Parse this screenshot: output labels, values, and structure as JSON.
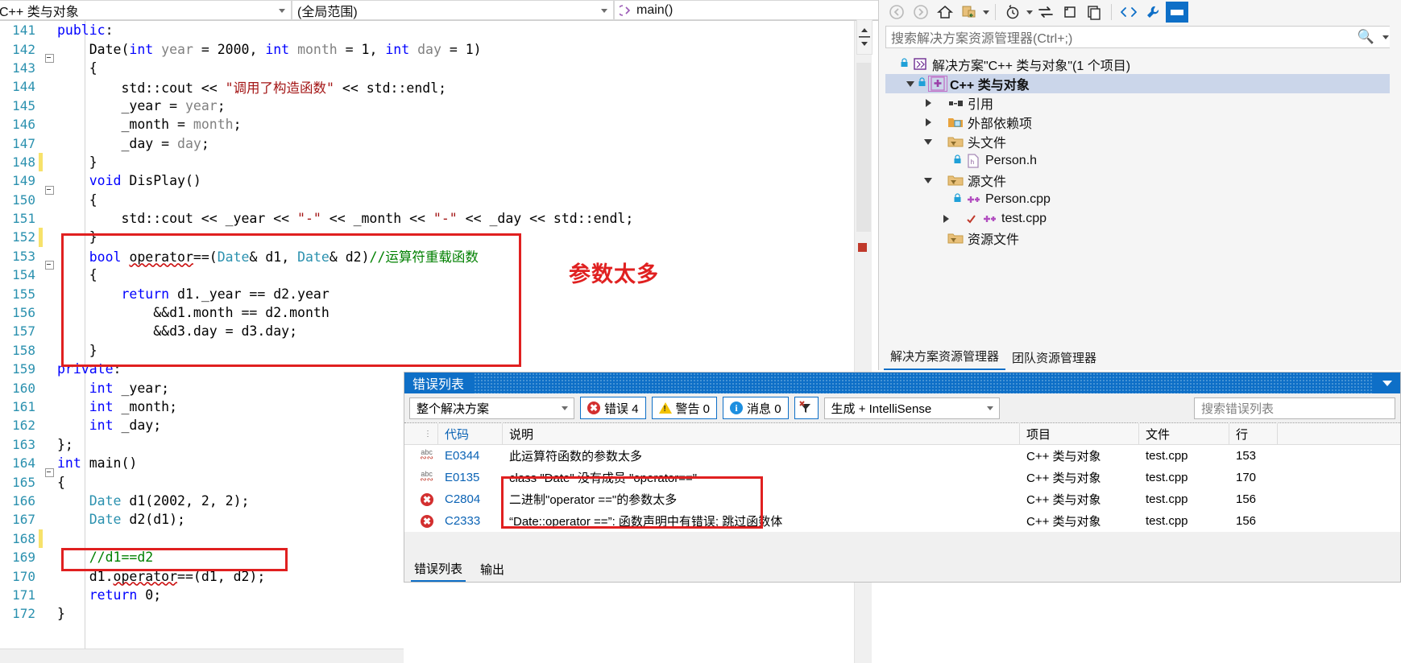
{
  "editor_nav": {
    "project_combo": "C++ 类与对象",
    "scope_combo": "(全局范围)",
    "member_combo": "main()",
    "member_icon": "method-icon"
  },
  "code": {
    "lines": [
      {
        "n": "141",
        "indent": 0,
        "glyph": "",
        "change": "",
        "tokens": [
          {
            "t": "public",
            "c": "kw"
          },
          {
            "t": ":",
            "c": "plain"
          }
        ]
      },
      {
        "n": "142",
        "indent": 0,
        "glyph": "box",
        "change": "",
        "tokens": [
          {
            "t": "    Date(",
            "c": "plain"
          },
          {
            "t": "int",
            "c": "kw"
          },
          {
            "t": " ",
            "c": "plain"
          },
          {
            "t": "year",
            "c": "param"
          },
          {
            "t": " = 2000, ",
            "c": "plain"
          },
          {
            "t": "int",
            "c": "kw"
          },
          {
            "t": " ",
            "c": "plain"
          },
          {
            "t": "month",
            "c": "param"
          },
          {
            "t": " = 1, ",
            "c": "plain"
          },
          {
            "t": "int",
            "c": "kw"
          },
          {
            "t": " ",
            "c": "plain"
          },
          {
            "t": "day",
            "c": "param"
          },
          {
            "t": " = 1)",
            "c": "plain"
          }
        ]
      },
      {
        "n": "143",
        "indent": 0,
        "glyph": "",
        "change": "",
        "tokens": [
          {
            "t": "    {",
            "c": "plain"
          }
        ]
      },
      {
        "n": "144",
        "indent": 0,
        "glyph": "",
        "change": "",
        "tokens": [
          {
            "t": "        std::cout << ",
            "c": "plain"
          },
          {
            "t": "\"调用了构造函数\"",
            "c": "str"
          },
          {
            "t": " << std::endl;",
            "c": "plain"
          }
        ]
      },
      {
        "n": "145",
        "indent": 0,
        "glyph": "",
        "change": "",
        "tokens": [
          {
            "t": "        _year = ",
            "c": "plain"
          },
          {
            "t": "year",
            "c": "param"
          },
          {
            "t": ";",
            "c": "plain"
          }
        ]
      },
      {
        "n": "146",
        "indent": 0,
        "glyph": "",
        "change": "",
        "tokens": [
          {
            "t": "        _month = ",
            "c": "plain"
          },
          {
            "t": "month",
            "c": "param"
          },
          {
            "t": ";",
            "c": "plain"
          }
        ]
      },
      {
        "n": "147",
        "indent": 0,
        "glyph": "",
        "change": "",
        "tokens": [
          {
            "t": "        _day = ",
            "c": "plain"
          },
          {
            "t": "day",
            "c": "param"
          },
          {
            "t": ";",
            "c": "plain"
          }
        ]
      },
      {
        "n": "148",
        "indent": 0,
        "glyph": "",
        "change": "yellow",
        "tokens": [
          {
            "t": "    }",
            "c": "plain"
          }
        ]
      },
      {
        "n": "149",
        "indent": 0,
        "glyph": "box",
        "change": "",
        "tokens": [
          {
            "t": "    ",
            "c": "plain"
          },
          {
            "t": "void",
            "c": "kw"
          },
          {
            "t": " DisPlay()",
            "c": "plain"
          }
        ]
      },
      {
        "n": "150",
        "indent": 0,
        "glyph": "",
        "change": "",
        "tokens": [
          {
            "t": "    {",
            "c": "plain"
          }
        ]
      },
      {
        "n": "151",
        "indent": 0,
        "glyph": "",
        "change": "",
        "tokens": [
          {
            "t": "        std::cout << _year << ",
            "c": "plain"
          },
          {
            "t": "\"-\"",
            "c": "str"
          },
          {
            "t": " << _month << ",
            "c": "plain"
          },
          {
            "t": "\"-\"",
            "c": "str"
          },
          {
            "t": " << _day << std::endl;",
            "c": "plain"
          }
        ]
      },
      {
        "n": "152",
        "indent": 0,
        "glyph": "",
        "change": "yellow",
        "tokens": [
          {
            "t": "    }",
            "c": "plain"
          }
        ]
      },
      {
        "n": "153",
        "indent": 0,
        "glyph": "box",
        "change": "",
        "tokens": [
          {
            "t": "    ",
            "c": "plain"
          },
          {
            "t": "bool",
            "c": "kw"
          },
          {
            "t": " ",
            "c": "plain"
          },
          {
            "t": "operator",
            "c": "squig-plain"
          },
          {
            "t": "==(",
            "c": "plain"
          },
          {
            "t": "Date",
            "c": "type"
          },
          {
            "t": "& d1, ",
            "c": "plain"
          },
          {
            "t": "Date",
            "c": "type"
          },
          {
            "t": "& d2)",
            "c": "plain"
          },
          {
            "t": "//运算符重载函数",
            "c": "cmt"
          }
        ]
      },
      {
        "n": "154",
        "indent": 0,
        "glyph": "",
        "change": "",
        "tokens": [
          {
            "t": "    {",
            "c": "plain"
          }
        ]
      },
      {
        "n": "155",
        "indent": 0,
        "glyph": "",
        "change": "",
        "tokens": [
          {
            "t": "        ",
            "c": "plain"
          },
          {
            "t": "return",
            "c": "kw"
          },
          {
            "t": " d1._year == d2.year",
            "c": "plain"
          }
        ]
      },
      {
        "n": "156",
        "indent": 0,
        "glyph": "",
        "change": "",
        "tokens": [
          {
            "t": "            &&d1.month == d2.month",
            "c": "plain"
          }
        ]
      },
      {
        "n": "157",
        "indent": 0,
        "glyph": "",
        "change": "",
        "tokens": [
          {
            "t": "            &&d3.day = d3.day;",
            "c": "plain"
          }
        ]
      },
      {
        "n": "158",
        "indent": 0,
        "glyph": "",
        "change": "",
        "tokens": [
          {
            "t": "    }",
            "c": "plain"
          }
        ]
      },
      {
        "n": "159",
        "indent": 0,
        "glyph": "",
        "change": "",
        "tokens": [
          {
            "t": "private",
            "c": "kw"
          },
          {
            "t": ":",
            "c": "plain"
          }
        ]
      },
      {
        "n": "160",
        "indent": 0,
        "glyph": "",
        "change": "",
        "tokens": [
          {
            "t": "    ",
            "c": "plain"
          },
          {
            "t": "int",
            "c": "kw"
          },
          {
            "t": " _year;",
            "c": "plain"
          }
        ]
      },
      {
        "n": "161",
        "indent": 0,
        "glyph": "",
        "change": "",
        "tokens": [
          {
            "t": "    ",
            "c": "plain"
          },
          {
            "t": "int",
            "c": "kw"
          },
          {
            "t": " _month;",
            "c": "plain"
          }
        ]
      },
      {
        "n": "162",
        "indent": 0,
        "glyph": "",
        "change": "",
        "tokens": [
          {
            "t": "    ",
            "c": "plain"
          },
          {
            "t": "int",
            "c": "kw"
          },
          {
            "t": " _day;",
            "c": "plain"
          }
        ]
      },
      {
        "n": "163",
        "indent": 0,
        "glyph": "",
        "change": "",
        "tokens": [
          {
            "t": "};",
            "c": "plain"
          }
        ]
      },
      {
        "n": "164",
        "indent": 0,
        "glyph": "box",
        "change": "",
        "tokens": [
          {
            "t": "int",
            "c": "kw"
          },
          {
            "t": " main()",
            "c": "plain"
          }
        ]
      },
      {
        "n": "165",
        "indent": 0,
        "glyph": "",
        "change": "",
        "tokens": [
          {
            "t": "{",
            "c": "plain"
          }
        ]
      },
      {
        "n": "166",
        "indent": 0,
        "glyph": "",
        "change": "",
        "tokens": [
          {
            "t": "    ",
            "c": "plain"
          },
          {
            "t": "Date",
            "c": "type"
          },
          {
            "t": " d1(2002, 2, 2);",
            "c": "plain"
          }
        ]
      },
      {
        "n": "167",
        "indent": 0,
        "glyph": "",
        "change": "",
        "tokens": [
          {
            "t": "    ",
            "c": "plain"
          },
          {
            "t": "Date",
            "c": "type"
          },
          {
            "t": " d2(d1);",
            "c": "plain"
          }
        ]
      },
      {
        "n": "168",
        "indent": 0,
        "glyph": "",
        "change": "yellow",
        "tokens": [
          {
            "t": "",
            "c": "plain"
          }
        ]
      },
      {
        "n": "169",
        "indent": 0,
        "glyph": "",
        "change": "",
        "tokens": [
          {
            "t": "    //d1==d2",
            "c": "cmt"
          }
        ]
      },
      {
        "n": "170",
        "indent": 0,
        "glyph": "",
        "change": "",
        "tokens": [
          {
            "t": "    d1.",
            "c": "plain"
          },
          {
            "t": "operator",
            "c": "squig-plain"
          },
          {
            "t": "==(d1, d2);",
            "c": "plain"
          }
        ]
      },
      {
        "n": "171",
        "indent": 0,
        "glyph": "",
        "change": "",
        "tokens": [
          {
            "t": "    ",
            "c": "plain"
          },
          {
            "t": "return",
            "c": "kw"
          },
          {
            "t": " 0;",
            "c": "plain"
          }
        ]
      },
      {
        "n": "172",
        "indent": 0,
        "glyph": "",
        "change": "",
        "tokens": [
          {
            "t": "}",
            "c": "plain"
          }
        ]
      }
    ],
    "annotation": "参数太多"
  },
  "solution_explorer": {
    "toolbar": [
      {
        "icon": "back-arrow-icon",
        "name": "navigate-back"
      },
      {
        "icon": "forward-arrow-icon",
        "name": "navigate-forward"
      },
      {
        "icon": "home-icon",
        "name": "home"
      },
      {
        "icon": "sync-with-document-icon",
        "name": "sync-with-active-document"
      },
      {
        "icon": "chevron-down-icon",
        "name": "sync-dropdown"
      },
      {
        "icon": "pending-changes-icon",
        "name": "pending-changes-filter"
      },
      {
        "icon": "chevron-down-icon",
        "name": "filter-dropdown"
      },
      {
        "icon": "refresh-icon",
        "name": "refresh"
      },
      {
        "icon": "collapse-all-icon",
        "name": "collapse-all"
      },
      {
        "icon": "show-all-files-icon",
        "name": "show-all-files"
      },
      {
        "icon": "code-view-icon",
        "name": "view-code"
      },
      {
        "icon": "properties-wrench-icon",
        "name": "properties"
      },
      {
        "icon": "preview-pane-icon",
        "name": "preview-selected-items"
      }
    ],
    "search_placeholder": "搜索解决方案资源管理器(Ctrl+;)",
    "tree": [
      {
        "level": 0,
        "expander": "none",
        "lock": true,
        "icon": "solution-icon",
        "label": "解决方案\"C++ 类与对象\"(1 个项目)",
        "selected": false,
        "bold": false
      },
      {
        "level": 1,
        "expander": "down",
        "lock": true,
        "icon": "cpp-project-icon",
        "label": "C++ 类与对象",
        "selected": true,
        "bold": true
      },
      {
        "level": 2,
        "expander": "right",
        "lock": false,
        "icon": "references-icon",
        "label": "引用",
        "selected": false,
        "bold": false
      },
      {
        "level": 2,
        "expander": "right",
        "lock": false,
        "icon": "ext-deps-icon",
        "label": "外部依赖项",
        "selected": false,
        "bold": false
      },
      {
        "level": 2,
        "expander": "down",
        "lock": false,
        "icon": "filter-folder-icon",
        "label": "头文件",
        "selected": false,
        "bold": false
      },
      {
        "level": 3,
        "expander": "none",
        "lock": true,
        "icon": "header-file-icon",
        "label": "Person.h",
        "selected": false,
        "bold": false
      },
      {
        "level": 2,
        "expander": "down",
        "lock": false,
        "icon": "filter-folder-icon",
        "label": "源文件",
        "selected": false,
        "bold": false
      },
      {
        "level": 3,
        "expander": "none",
        "lock": true,
        "icon": "cpp-file-icon",
        "label": "Person.cpp",
        "selected": false,
        "bold": false
      },
      {
        "level": 3,
        "expander": "right",
        "lock": false,
        "icon": "cpp-file-check-icon",
        "label": "test.cpp",
        "selected": false,
        "bold": false
      },
      {
        "level": 2,
        "expander": "none",
        "lock": false,
        "icon": "filter-folder-icon",
        "label": "资源文件",
        "selected": false,
        "bold": false
      }
    ],
    "tabs": [
      {
        "label": "解决方案资源管理器",
        "active": true
      },
      {
        "label": "团队资源管理器",
        "active": false
      }
    ]
  },
  "error_list": {
    "title": "错误列表",
    "scope_filter": "整个解决方案",
    "errors_label": "错误 4",
    "warnings_label": "警告 0",
    "messages_label": "消息 0",
    "build_filter": "生成 + IntelliSense",
    "search_placeholder": "搜索错误列表",
    "columns": [
      "",
      "代码",
      "说明",
      "项目",
      "文件",
      "行"
    ],
    "rows": [
      {
        "severity": "intellisense",
        "code": "E0344",
        "description": "此运算符函数的参数太多",
        "project": "C++ 类与对象",
        "file": "test.cpp",
        "line": "153"
      },
      {
        "severity": "intellisense",
        "code": "E0135",
        "description": "class \"Date\" 没有成员 \"operator==\"",
        "project": "C++ 类与对象",
        "file": "test.cpp",
        "line": "170"
      },
      {
        "severity": "error",
        "code": "C2804",
        "description": "二进制\"operator ==\"的参数太多",
        "project": "C++ 类与对象",
        "file": "test.cpp",
        "line": "156"
      },
      {
        "severity": "error",
        "code": "C2333",
        "description": "“Date::operator ==”: 函数声明中有错误; 跳过函数体",
        "project": "C++ 类与对象",
        "file": "test.cpp",
        "line": "156"
      }
    ],
    "bottom_tabs": [
      {
        "label": "错误列表",
        "active": true
      },
      {
        "label": "输出",
        "active": false
      }
    ]
  },
  "colors": {
    "accent_blue": "#0e6fc7",
    "annotation_red": "#e02020",
    "keyword_blue": "#0000ff",
    "type_teal": "#2b91af",
    "string_red": "#a31515",
    "comment_green": "#008000"
  }
}
